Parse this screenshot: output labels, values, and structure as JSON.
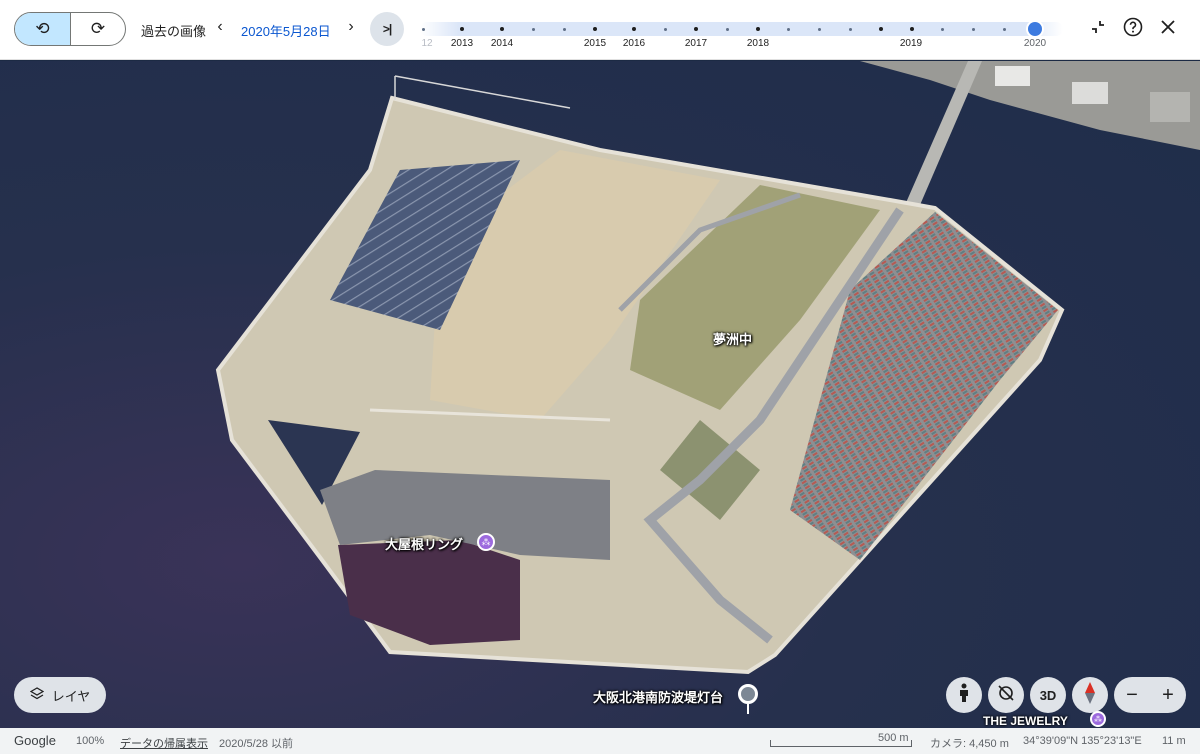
{
  "topbar": {
    "history_label": "過去の画像",
    "prev_label": "‹",
    "next_label": "›",
    "date": "2020年5月28日",
    "latest_label": ">|",
    "timeline_years": [
      "12",
      "2013",
      "2014",
      "2015",
      "2016",
      "2017",
      "2018",
      "2019",
      "2020"
    ],
    "selected_year": "2020"
  },
  "map": {
    "labels": {
      "yumeshima": "夢洲中",
      "ring": "大屋根リング",
      "lighthouse": "大阪北港南防波堤灯台",
      "jewelry": "THE JEWELRY"
    },
    "layer_button": "レイヤ",
    "view_3d": "3D",
    "zoom_out": "−",
    "zoom_in": "+"
  },
  "bottombar": {
    "brand": "Google",
    "zoom": "100%",
    "data_attribution": "データの帰属表示",
    "imagery_date": "2020/5/28 以前",
    "scale": "500 m",
    "camera": "カメラ: 4,450 m",
    "coords": "34°39'09\"N 135°23'13\"E",
    "altitude": "11 m"
  },
  "colors": {
    "accent": "#0b57d0",
    "selected_segment": "#c2e7ff",
    "timeline_handle": "#3d7be0",
    "water": "#1f2d4a"
  }
}
